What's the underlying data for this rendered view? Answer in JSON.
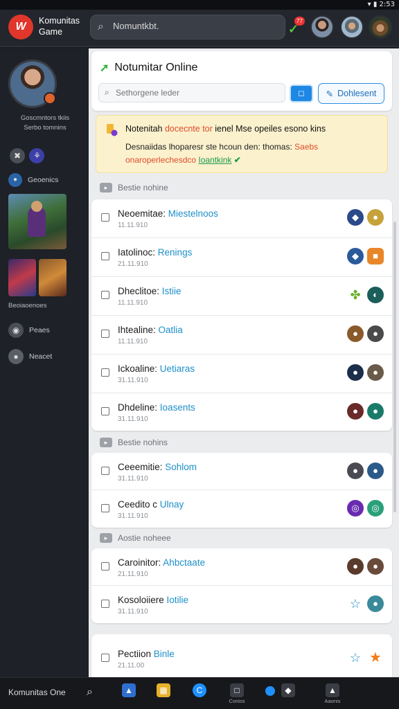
{
  "status_bar": {
    "time": "2:53",
    "icons": [
      "wifi-icon",
      "battery-icon"
    ]
  },
  "header": {
    "logo_text": "W",
    "app_name": "Komunitas Game",
    "search": {
      "value": "Nomuntkbt.",
      "placeholder": "Nomuntkbt."
    },
    "notification_count": "77",
    "avatars": [
      "avatar-bearded-man",
      "avatar-hooded-character",
      "avatar-cowboy"
    ]
  },
  "sidebar": {
    "profile_caption_1": "Goscmntors tkiis",
    "profile_caption_2": "Serbo tomnins",
    "section_label": "Geoenics",
    "game_section_caption": "Beoiaoenoes",
    "item_1": "Peaes",
    "item_2": "Neacet"
  },
  "main": {
    "title": "Notumitar Online",
    "filter_placeholder": "Sethorgene leder",
    "primary_button": "Dohlesent",
    "banner": {
      "line1_a": "Notenitah ",
      "line1_hl": "docecnte tor",
      "line1_b": " ienel Mse opeiles esono kins",
      "line2_a": "Desnaiidas lhoparesr ste hcoun den: thomas: ",
      "line2_hl": "Saebs",
      "line3_a": "onaroperlechesdco ",
      "line3_link": "Ioantkink"
    },
    "groups": [
      {
        "label": "Bestie nohine",
        "rows": [
          {
            "name": "Neoemitae: ",
            "accent": "Miestelnoos",
            "date": "11.11.910"
          },
          {
            "name": "Iatolinoc: ",
            "accent": "Renings",
            "date": "21.11.910"
          },
          {
            "name": "Dheclitoe: ",
            "accent": "Istiie",
            "date": "11.11.910"
          },
          {
            "name": "Ihtealine: ",
            "accent": "Oatlia",
            "date": "11.11.910"
          },
          {
            "name": "Ickoaline: ",
            "accent": "Uetiaras",
            "date": "31.11.910"
          },
          {
            "name": "Dhdeline: ",
            "accent": "Ioasents",
            "date": "31.11.910"
          }
        ]
      },
      {
        "label": "Bestie nohins",
        "rows": [
          {
            "name": "Ceeemitie: ",
            "accent": "Sohlom",
            "date": "31.11.910"
          },
          {
            "name": "Ceedito c ",
            "accent": "Ulnay",
            "date": "31.11.910"
          }
        ]
      },
      {
        "label": "Aostie noheee",
        "rows": [
          {
            "name": "Caroinitor: ",
            "accent": "Ahbctaate",
            "date": "21.11.910"
          },
          {
            "name": "Kosoloiiere ",
            "accent": "Iotilie",
            "date": "31.11.910"
          }
        ]
      },
      {
        "label": "",
        "rows": [
          {
            "name": "Pectiion ",
            "accent": "Binle",
            "date": "21.11.00"
          }
        ]
      }
    ]
  },
  "bottom_nav": {
    "label": "Komunitas One",
    "items": [
      "home-icon",
      "calendar-icon",
      "community-icon",
      "chat-icon",
      "shield-icon",
      "profile-icon"
    ],
    "captions": [
      "",
      "",
      "",
      "Coniss",
      "",
      "Aaonis"
    ]
  },
  "colors": {
    "accent": "#1d8fc8",
    "brand": "#e0362b",
    "warning_bg": "#fbf1cd"
  }
}
